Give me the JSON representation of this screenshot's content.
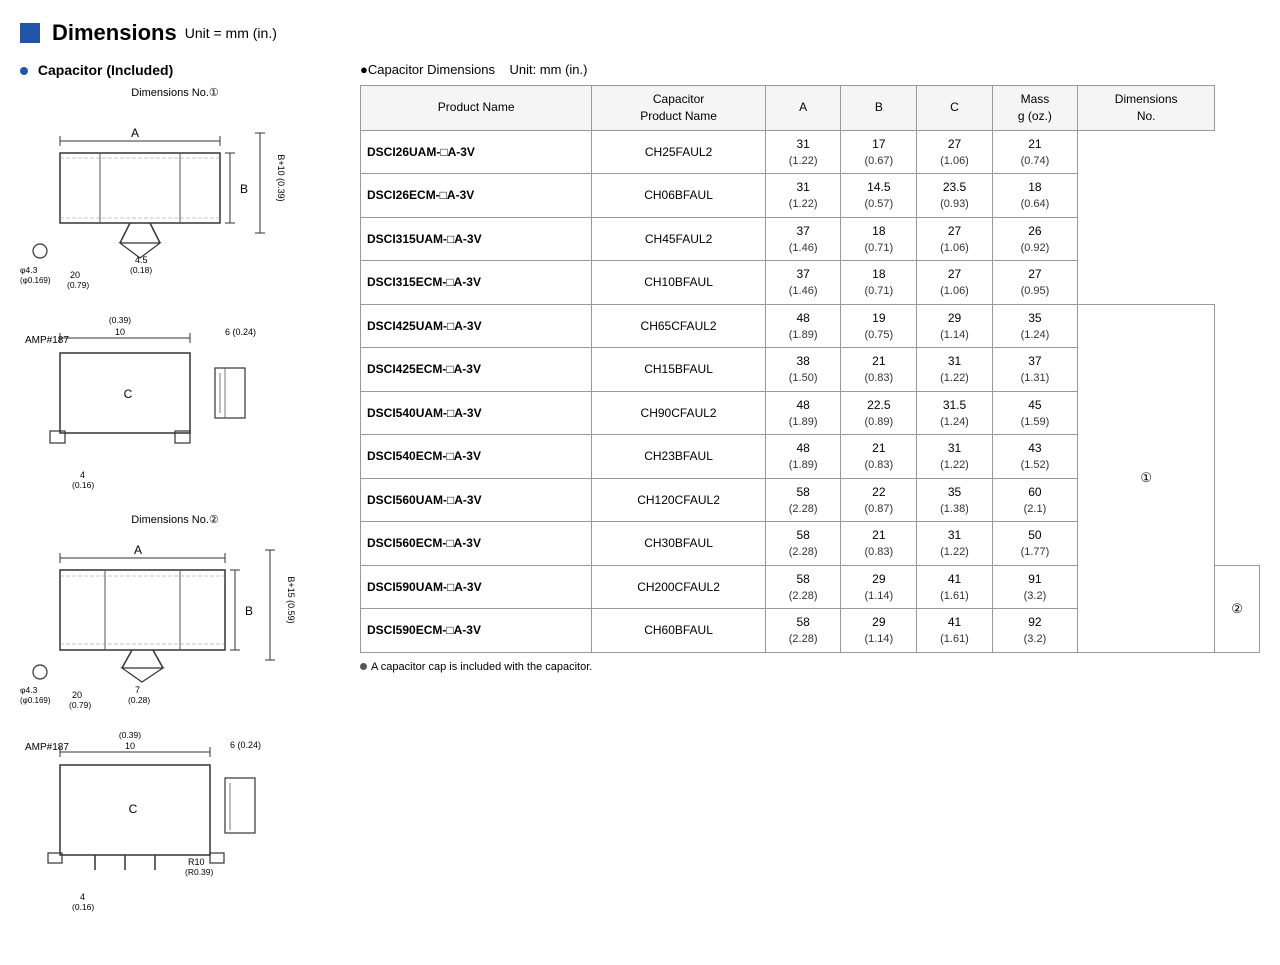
{
  "header": {
    "title": "Dimensions",
    "unit": "Unit = mm (in.)"
  },
  "left_section": {
    "subtitle": "Capacitor (Included)",
    "dim1_label": "Dimensions No.①",
    "dim2_label": "Dimensions No.②"
  },
  "right_section": {
    "title": "●Capacitor Dimensions",
    "unit": "Unit: mm (in.)",
    "columns": [
      "Product Name",
      "Capacitor\nProduct Name",
      "A",
      "B",
      "C",
      "Mass\ng (oz.)",
      "Dimensions\nNo."
    ],
    "rows": [
      {
        "product_name": "DSCI26UAM-□A-3V",
        "cap_product": "CH25FAUL2",
        "a": "31",
        "a_sub": "(1.22)",
        "b": "17",
        "b_sub": "(0.67)",
        "c": "27",
        "c_sub": "(1.06)",
        "mass": "21",
        "mass_sub": "(0.74)",
        "dim_no": ""
      },
      {
        "product_name": "DSCI26ECM-□A-3V",
        "cap_product": "CH06BFAUL",
        "a": "31",
        "a_sub": "(1.22)",
        "b": "14.5",
        "b_sub": "(0.57)",
        "c": "23.5",
        "c_sub": "(0.93)",
        "mass": "18",
        "mass_sub": "(0.64)",
        "dim_no": ""
      },
      {
        "product_name": "DSCI315UAM-□A-3V",
        "cap_product": "CH45FAUL2",
        "a": "37",
        "a_sub": "(1.46)",
        "b": "18",
        "b_sub": "(0.71)",
        "c": "27",
        "c_sub": "(1.06)",
        "mass": "26",
        "mass_sub": "(0.92)",
        "dim_no": ""
      },
      {
        "product_name": "DSCI315ECM-□A-3V",
        "cap_product": "CH10BFAUL",
        "a": "37",
        "a_sub": "(1.46)",
        "b": "18",
        "b_sub": "(0.71)",
        "c": "27",
        "c_sub": "(1.06)",
        "mass": "27",
        "mass_sub": "(0.95)",
        "dim_no": ""
      },
      {
        "product_name": "DSCI425UAM-□A-3V",
        "cap_product": "CH65CFAUL2",
        "a": "48",
        "a_sub": "(1.89)",
        "b": "19",
        "b_sub": "(0.75)",
        "c": "29",
        "c_sub": "(1.14)",
        "mass": "35",
        "mass_sub": "(1.24)",
        "dim_no": "①"
      },
      {
        "product_name": "DSCI425ECM-□A-3V",
        "cap_product": "CH15BFAUL",
        "a": "38",
        "a_sub": "(1.50)",
        "b": "21",
        "b_sub": "(0.83)",
        "c": "31",
        "c_sub": "(1.22)",
        "mass": "37",
        "mass_sub": "(1.31)",
        "dim_no": ""
      },
      {
        "product_name": "DSCI540UAM-□A-3V",
        "cap_product": "CH90CFAUL2",
        "a": "48",
        "a_sub": "(1.89)",
        "b": "22.5",
        "b_sub": "(0.89)",
        "c": "31.5",
        "c_sub": "(1.24)",
        "mass": "45",
        "mass_sub": "(1.59)",
        "dim_no": ""
      },
      {
        "product_name": "DSCI540ECM-□A-3V",
        "cap_product": "CH23BFAUL",
        "a": "48",
        "a_sub": "(1.89)",
        "b": "21",
        "b_sub": "(0.83)",
        "c": "31",
        "c_sub": "(1.22)",
        "mass": "43",
        "mass_sub": "(1.52)",
        "dim_no": ""
      },
      {
        "product_name": "DSCI560UAM-□A-3V",
        "cap_product": "CH120CFAUL2",
        "a": "58",
        "a_sub": "(2.28)",
        "b": "22",
        "b_sub": "(0.87)",
        "c": "35",
        "c_sub": "(1.38)",
        "mass": "60",
        "mass_sub": "(2.1)",
        "dim_no": ""
      },
      {
        "product_name": "DSCI560ECM-□A-3V",
        "cap_product": "CH30BFAUL",
        "a": "58",
        "a_sub": "(2.28)",
        "b": "21",
        "b_sub": "(0.83)",
        "c": "31",
        "c_sub": "(1.22)",
        "mass": "50",
        "mass_sub": "(1.77)",
        "dim_no": ""
      },
      {
        "product_name": "DSCI590UAM-□A-3V",
        "cap_product": "CH200CFAUL2",
        "a": "58",
        "a_sub": "(2.28)",
        "b": "29",
        "b_sub": "(1.14)",
        "c": "41",
        "c_sub": "(1.61)",
        "mass": "91",
        "mass_sub": "(3.2)",
        "dim_no": "②"
      },
      {
        "product_name": "DSCI590ECM-□A-3V",
        "cap_product": "CH60BFAUL",
        "a": "58",
        "a_sub": "(2.28)",
        "b": "29",
        "b_sub": "(1.14)",
        "c": "41",
        "c_sub": "(1.61)",
        "mass": "92",
        "mass_sub": "(3.2)",
        "dim_no": ""
      }
    ],
    "footnote": "A capacitor cap is included with the capacitor."
  }
}
